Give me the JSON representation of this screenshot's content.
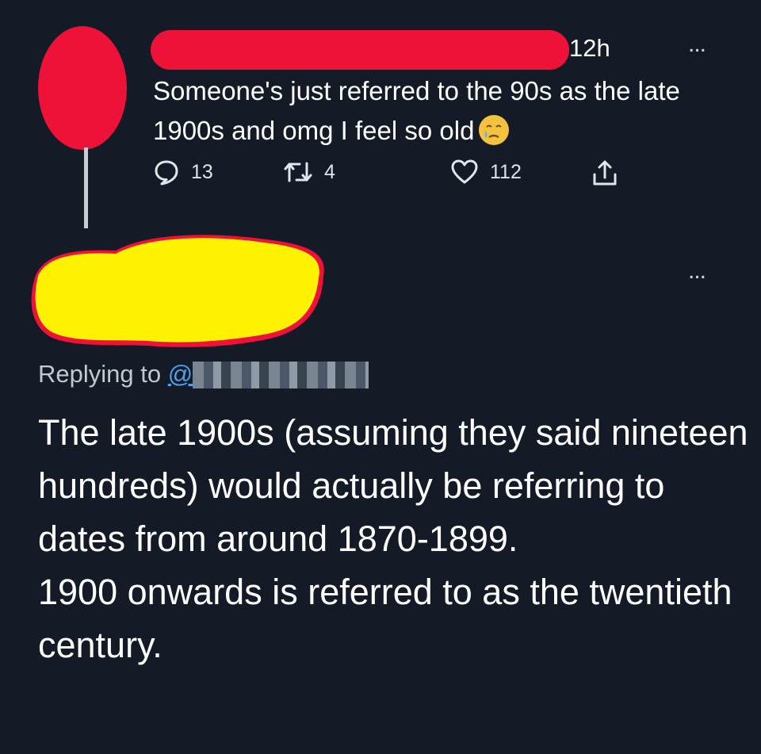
{
  "tweet1": {
    "timestamp": "12h",
    "more_label": "...",
    "text": "Someone's just referred to the 90s as the late 1900s and omg I feel so old",
    "emoji": "crying-face-emoji",
    "replies": "13",
    "retweets": "4",
    "likes": "112"
  },
  "tweet2": {
    "more_label": "...",
    "replying_prefix": "Replying to",
    "handle_visible": "@",
    "paragraphs": [
      "The late 1900s (assuming they said nineteen hundreds) would actually be referring to dates from around 1870-1899.",
      "1900 onwards is referred to as the twentieth century."
    ]
  },
  "colors": {
    "background": "#141b26",
    "redaction_red": "#ee1238",
    "redaction_yellow": "#fff200",
    "link_blue": "#4ca0ec"
  }
}
